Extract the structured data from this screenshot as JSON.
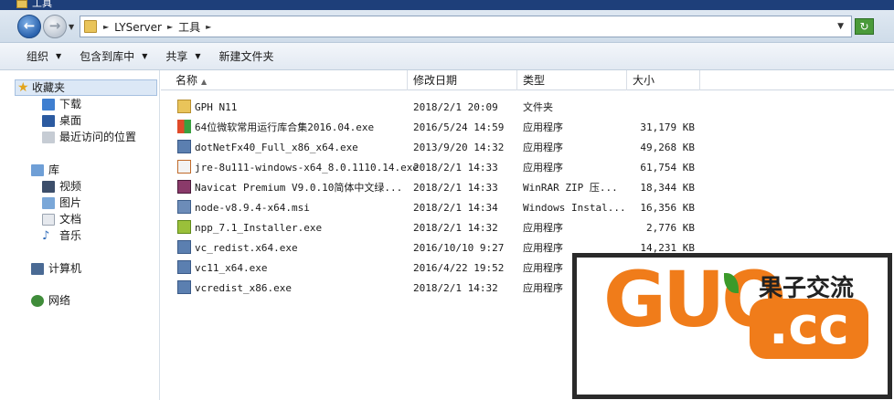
{
  "window": {
    "title": "工具"
  },
  "address": {
    "crumbs": [
      "LYServer",
      "工具"
    ]
  },
  "toolbar": [
    {
      "label": "组织",
      "caret": true
    },
    {
      "label": "包含到库中",
      "caret": true
    },
    {
      "label": "共享",
      "caret": true
    },
    {
      "label": "新建文件夹",
      "caret": false
    }
  ],
  "sidebar": {
    "favorites": {
      "label": "收藏夹",
      "items": [
        "下载",
        "桌面",
        "最近访问的位置"
      ]
    },
    "libraries": {
      "label": "库",
      "items": [
        "视频",
        "图片",
        "文档",
        "音乐"
      ]
    },
    "computer": "计算机",
    "network": "网络"
  },
  "columns": {
    "name": "名称",
    "date": "修改日期",
    "type": "类型",
    "size": "大小"
  },
  "files": [
    {
      "name": "GPH N11",
      "date": "2018/2/1 20:09",
      "type": "文件夹",
      "size": "",
      "icon": "folder-icon"
    },
    {
      "name": "64位微软常用运行库合集2016.04.exe",
      "date": "2016/5/24 14:59",
      "type": "应用程序",
      "size": "31,179 KB",
      "icon": "windows-app-icon"
    },
    {
      "name": "dotNetFx40_Full_x86_x64.exe",
      "date": "2013/9/20 14:32",
      "type": "应用程序",
      "size": "49,268 KB",
      "icon": "installer-icon"
    },
    {
      "name": "jre-8u111-windows-x64_8.0.1110.14.exe",
      "date": "2018/2/1 14:33",
      "type": "应用程序",
      "size": "61,754 KB",
      "icon": "java-icon"
    },
    {
      "name": "Navicat Premium V9.0.10简体中文绿...",
      "date": "2018/2/1 14:33",
      "type": "WinRAR ZIP 压...",
      "size": "18,344 KB",
      "icon": "winrar-icon"
    },
    {
      "name": "node-v8.9.4-x64.msi",
      "date": "2018/2/1 14:34",
      "type": "Windows Instal...",
      "size": "16,356 KB",
      "icon": "msi-icon"
    },
    {
      "name": "npp_7.1_Installer.exe",
      "date": "2018/2/1 14:32",
      "type": "应用程序",
      "size": "2,776 KB",
      "icon": "notepad-icon"
    },
    {
      "name": "vc_redist.x64.exe",
      "date": "2016/10/10 9:27",
      "type": "应用程序",
      "size": "14,231 KB",
      "icon": "installer-icon"
    },
    {
      "name": "vc11_x64.exe",
      "date": "2016/4/22 19:52",
      "type": "应用程序",
      "size": "",
      "icon": "installer-icon"
    },
    {
      "name": "vcredist_x86.exe",
      "date": "2018/2/1 14:32",
      "type": "应用程序",
      "size": "",
      "icon": "installer-icon"
    }
  ],
  "watermark": {
    "logo_text": "GUO",
    "domain_text": ".cc",
    "tagline": "果子交流"
  },
  "colors": {
    "titlebar": "#1e3f7a",
    "watermark_orange": "#f07c1a",
    "selection": "#dce8f6"
  }
}
